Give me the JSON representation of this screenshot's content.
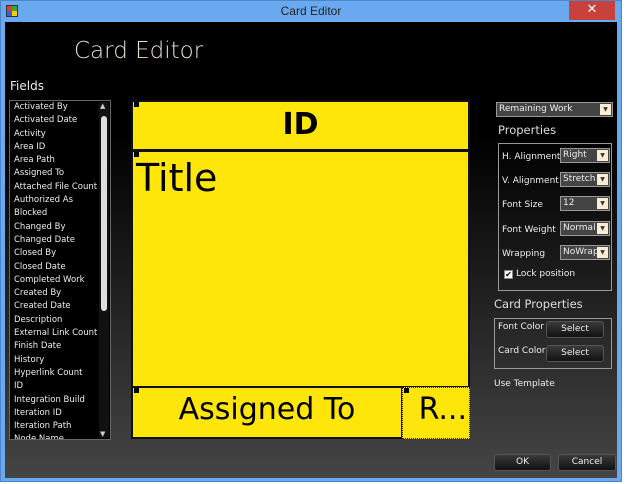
{
  "window": {
    "title": "Card Editor",
    "close": "✕"
  },
  "heading": "Card Editor",
  "fields": {
    "label": "Fields",
    "items": [
      "Activated By",
      "Activated Date",
      "Activity",
      "Area ID",
      "Area Path",
      "Assigned To",
      "Attached File Count",
      "Authorized As",
      "Blocked",
      "Changed By",
      "Changed Date",
      "Closed By",
      "Closed Date",
      "Completed Work",
      "Created By",
      "Created Date",
      "Description",
      "External Link Count",
      "Finish Date",
      "History",
      "Hyperlink Count",
      "ID",
      "Integration Build",
      "Iteration ID",
      "Iteration Path",
      "Node Name"
    ]
  },
  "card": {
    "id": "ID",
    "title": "Title",
    "assigned": "Assigned To",
    "remaining": "R...",
    "color": "#ffe60a"
  },
  "selected_field": "Remaining Work",
  "properties": {
    "label": "Properties",
    "h_align": {
      "label": "H. Alignment",
      "value": "Right"
    },
    "v_align": {
      "label": "V. Alignment",
      "value": "Stretch"
    },
    "font_size": {
      "label": "Font Size",
      "value": "12"
    },
    "font_weight": {
      "label": "Font Weight",
      "value": "Normal"
    },
    "wrapping": {
      "label": "Wrapping",
      "value": "NoWrap"
    },
    "lock": {
      "label": "Lock position",
      "checked": true
    }
  },
  "card_properties": {
    "label": "Card Properties",
    "font_color": "Font Color",
    "card_color": "Card Color",
    "select": "Select"
  },
  "use_template": "Use Template",
  "ok": "OK",
  "cancel": "Cancel"
}
